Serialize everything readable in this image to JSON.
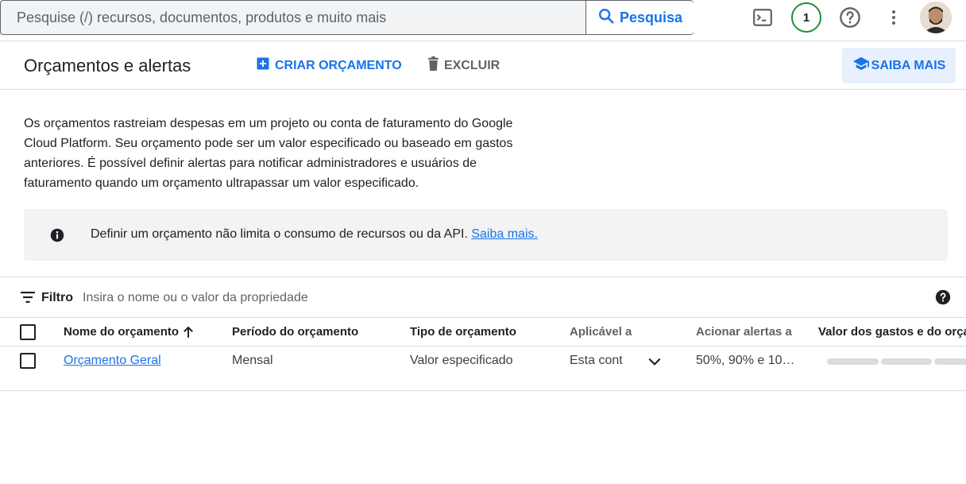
{
  "search": {
    "placeholder": "Pesquise (/) recursos, documentos, produtos e muito mais",
    "button_label": "Pesquisa"
  },
  "topbar": {
    "notification_count": "1",
    "icons": [
      "cloud-shell-icon",
      "help-icon",
      "more-vert-icon"
    ]
  },
  "header": {
    "title": "Orçamentos e alertas",
    "create_label": "CRIAR ORÇAMENTO",
    "delete_label": "EXCLUIR",
    "learn_label": "SAIBA MAIS"
  },
  "description": "Os orçamentos rastreiam despesas em um projeto ou conta de faturamento do Google Cloud Platform. Seu orçamento pode ser um valor especificado ou baseado em gastos anteriores. É possível definir alertas para notificar administradores e usuários de faturamento quando um orçamento ultrapassar um valor especificado.",
  "info": {
    "text": "Definir um orçamento não limita o consumo de recursos ou da API.",
    "link": "Saiba mais."
  },
  "filter": {
    "label": "Filtro",
    "placeholder": "Insira o nome ou o valor da propriedade"
  },
  "table": {
    "columns": [
      "Nome do orçamento",
      "Período do orçamento",
      "Tipo de orçamento",
      "Aplicável a",
      "Acionar alertas a",
      "Valor dos gastos e do orçam"
    ],
    "rows": [
      {
        "name": "Orçamento Geral",
        "period": "Mensal",
        "type": "Valor especificado",
        "applies_to": "Esta cont",
        "alerts": "50%, 90% e 10…"
      }
    ]
  },
  "colors": {
    "accent": "#1a73e8",
    "notif_ring": "#1e8e3e",
    "info_bg": "#f1f3f4"
  }
}
